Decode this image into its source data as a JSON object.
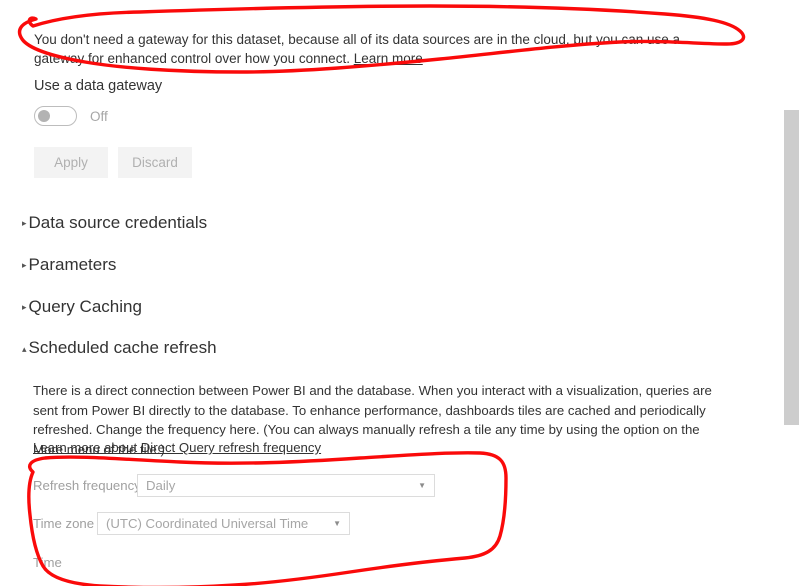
{
  "gateway": {
    "notice_text": "You don't need a gateway for this dataset, because all of its data sources are in the cloud, but you can use a gateway for enhanced control over how you connect. ",
    "notice_link": "Learn more",
    "toggle_label": "Use a data gateway",
    "toggle_state": "Off",
    "apply_label": "Apply",
    "discard_label": "Discard"
  },
  "sections": [
    {
      "id": "data-source-credentials",
      "label": "Data source credentials",
      "expanded": false,
      "caret": "▸"
    },
    {
      "id": "parameters",
      "label": "Parameters",
      "expanded": false,
      "caret": "▸"
    },
    {
      "id": "query-caching",
      "label": "Query Caching",
      "expanded": false,
      "caret": "▸"
    },
    {
      "id": "scheduled-cache-refresh",
      "label": "Scheduled cache refresh",
      "expanded": true,
      "caret": "▴"
    }
  ],
  "scheduled_cache_refresh": {
    "description": "There is a direct connection between Power BI and the database. When you interact with a visualization, queries are sent from Power BI directly to the database. To enhance performance, dashboards tiles are cached and periodically refreshed. Change the frequency here. (You can always manually refresh a tile any time by using the option on the More menu of the tile.)",
    "link": "Learn more about Direct Query refresh frequency",
    "fields": {
      "refresh_frequency_label": "Refresh frequency",
      "refresh_frequency_value": "Daily",
      "time_zone_label": "Time zone",
      "time_zone_value": "(UTC) Coordinated Universal Time",
      "time_label": "Time"
    }
  },
  "annotations": {
    "color": "#fa0a0a",
    "shapes": [
      {
        "name": "annotation-ellipse-gateway-notice"
      },
      {
        "name": "annotation-ellipse-refresh-settings"
      }
    ]
  },
  "icons": {
    "caret_collapsed": "▸",
    "caret_expanded": "▴",
    "dropdown_caret": "▼"
  }
}
